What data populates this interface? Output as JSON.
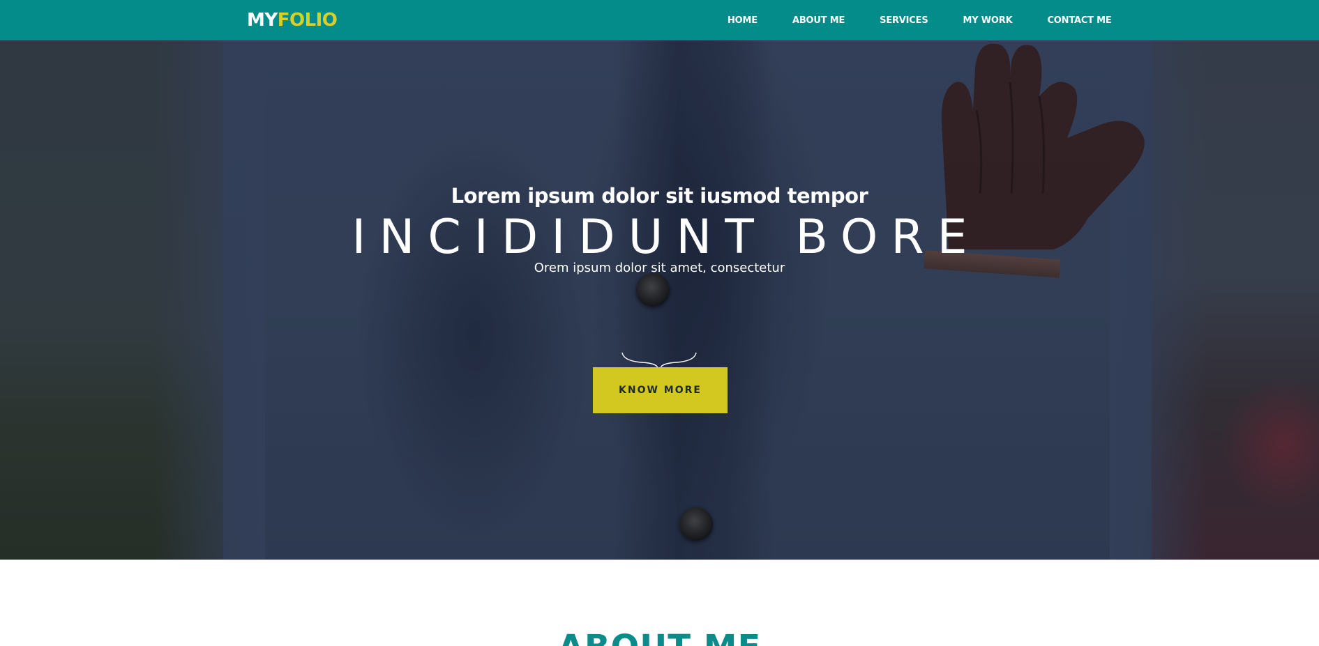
{
  "colors": {
    "nav_background": "#048c8a",
    "logo_accent": "#d7cf2a",
    "button_background": "#d3c81f",
    "heading_teal": "#0b8b89"
  },
  "logo": {
    "part_a": "MY",
    "part_b": "FOLIO"
  },
  "nav": {
    "items": [
      {
        "label": "HOME"
      },
      {
        "label": "ABOUT ME"
      },
      {
        "label": "SERVICES"
      },
      {
        "label": "MY WORK"
      },
      {
        "label": "CONTACT ME"
      }
    ]
  },
  "hero": {
    "subtitle": "Lorem ipsum dolor sit iusmod tempor",
    "title": "INCIDIDUNT BORE",
    "tagline": "Orem ipsum dolor sit amet, consectetur",
    "divider_icon": "curly-brace-icon",
    "button_label": "KNOW MORE"
  },
  "about": {
    "heading": "ABOUT ME"
  }
}
